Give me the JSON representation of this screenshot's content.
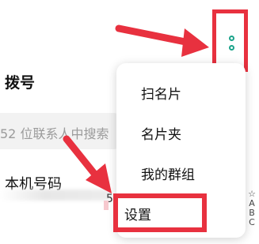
{
  "header": {
    "title": "拨号"
  },
  "search": {
    "placeholder": "52 位联系人中搜索"
  },
  "contacts": {
    "my_number_label": "本机号码",
    "number_fragment": "5"
  },
  "popup_menu": {
    "items": [
      {
        "label": "扫名片"
      },
      {
        "label": "名片夹"
      },
      {
        "label": "我的群组"
      },
      {
        "label": "设置"
      }
    ]
  },
  "alpha_index": [
    "☆",
    "A",
    "B",
    "C"
  ],
  "colors": {
    "highlight_red": "#e8313f",
    "accent_green": "#1ba38a"
  }
}
